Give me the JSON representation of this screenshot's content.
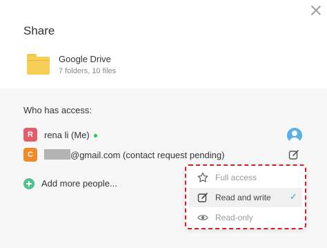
{
  "dialog": {
    "title": "Share",
    "close_icon": "close-icon"
  },
  "folder": {
    "name": "Google Drive",
    "meta": "7 folders, 10 files",
    "icon": "folder-icon",
    "color": "#f7cf57"
  },
  "access": {
    "label": "Who has access:",
    "people": [
      {
        "initial": "R",
        "name": "rena li (Me)",
        "avatar_color": "#e35d6a",
        "status": "online",
        "role_icon": "profile-icon"
      },
      {
        "initial": "C",
        "email_suffix": "@gmail.com (contact request pending)",
        "avatar_color": "#f08a28",
        "role_icon": "edit-icon"
      }
    ],
    "add_more_label": "Add more people..."
  },
  "permission_menu": {
    "items": [
      {
        "label": "Full access",
        "icon": "star-icon",
        "selected": false
      },
      {
        "label": "Read and write",
        "icon": "edit-icon",
        "selected": true
      },
      {
        "label": "Read-only",
        "icon": "eye-icon",
        "selected": false
      }
    ],
    "check_mark": "✓",
    "highlight_color": "#cc1f2a"
  }
}
